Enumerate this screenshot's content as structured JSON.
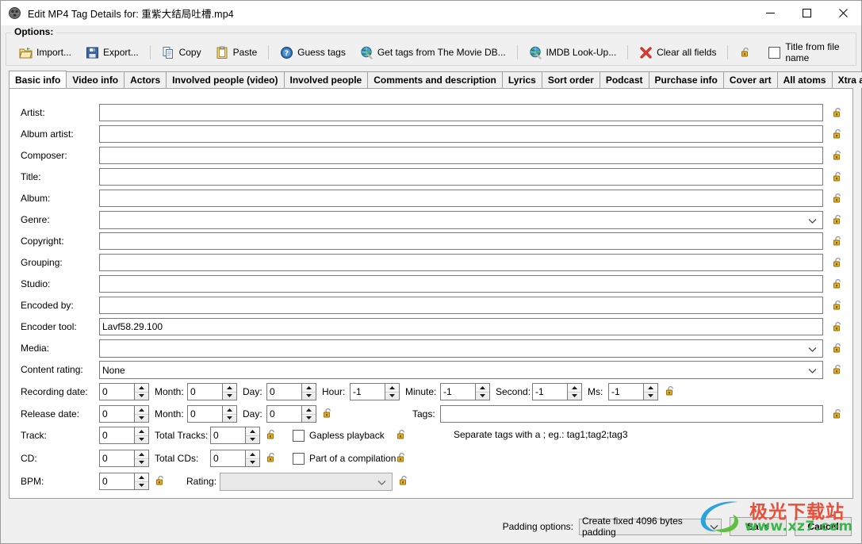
{
  "window": {
    "title": "Edit MP4 Tag Details for: 重紫大结局吐槽.mp4",
    "icon": "app-icon",
    "minimize": "–",
    "maximize": "□",
    "close": "✕"
  },
  "options": {
    "group_label": "Options:",
    "items": [
      {
        "label": "Import...",
        "icon": "open-folder-icon"
      },
      {
        "label": "Export...",
        "icon": "floppy-disk-icon"
      },
      {
        "label": "Copy",
        "icon": "copy-icon"
      },
      {
        "label": "Paste",
        "icon": "paste-icon"
      },
      {
        "label": "Guess tags",
        "icon": "question-circle-icon"
      },
      {
        "label": "Get tags from The Movie DB...",
        "icon": "globe-icon"
      },
      {
        "label": "IMDB Look-Up...",
        "icon": "globe-icon"
      },
      {
        "label": "Clear all fields",
        "icon": "red-x-icon"
      }
    ],
    "lock_icon": "unlocked-padlock-icon",
    "title_from_file": "Title from file name",
    "title_from_file_checked": false
  },
  "tabs": [
    {
      "label": "Basic info",
      "active": true
    },
    {
      "label": "Video info",
      "active": false
    },
    {
      "label": "Actors",
      "active": false
    },
    {
      "label": "Involved people (video)",
      "active": false
    },
    {
      "label": "Involved people",
      "active": false
    },
    {
      "label": "Comments and description",
      "active": false
    },
    {
      "label": "Lyrics",
      "active": false
    },
    {
      "label": "Sort order",
      "active": false
    },
    {
      "label": "Podcast",
      "active": false
    },
    {
      "label": "Purchase info",
      "active": false
    },
    {
      "label": "Cover art",
      "active": false
    },
    {
      "label": "All atoms",
      "active": false
    },
    {
      "label": "Xtra atom",
      "active": false
    }
  ],
  "basic_info": {
    "text_fields": [
      {
        "label": "Artist:",
        "value": ""
      },
      {
        "label": "Album artist:",
        "value": ""
      },
      {
        "label": "Composer:",
        "value": ""
      },
      {
        "label": "Title:",
        "value": ""
      },
      {
        "label": "Album:",
        "value": ""
      }
    ],
    "genre": {
      "label": "Genre:",
      "value": ""
    },
    "text_fields2": [
      {
        "label": "Copyright:",
        "value": ""
      },
      {
        "label": "Grouping:",
        "value": ""
      },
      {
        "label": "Studio:",
        "value": ""
      },
      {
        "label": "Encoded by:",
        "value": ""
      },
      {
        "label": "Encoder tool:",
        "value": "Lavf58.29.100"
      }
    ],
    "media": {
      "label": "Media:",
      "value": ""
    },
    "content_rating": {
      "label": "Content rating:",
      "value": "None"
    },
    "recording_date": {
      "label": "Recording date:",
      "year": "0",
      "month_label": "Month:",
      "month": "0",
      "day_label": "Day:",
      "day": "0",
      "hour_label": "Hour:",
      "hour": "-1",
      "minute_label": "Minute:",
      "minute": "-1",
      "second_label": "Second:",
      "second": "-1",
      "ms_label": "Ms:",
      "ms": "-1"
    },
    "release_date": {
      "label": "Release date:",
      "year": "0",
      "month_label": "Month:",
      "month": "0",
      "day_label": "Day:",
      "day": "0"
    },
    "tags": {
      "label": "Tags:",
      "value": "",
      "hint": "Separate tags with a ; eg.: tag1;tag2;tag3"
    },
    "track": {
      "label": "Track:",
      "value": "0",
      "total_label": "Total Tracks:",
      "total": "0",
      "checkbox_label": "Gapless playback",
      "checked": false
    },
    "cd": {
      "label": "CD:",
      "value": "0",
      "total_label": "Total CDs:",
      "total": "0",
      "checkbox_label": "Part of a compilation",
      "checked": false
    },
    "bpm": {
      "label": "BPM:",
      "value": "0",
      "rating_label": "Rating:",
      "rating_value": ""
    }
  },
  "footer": {
    "padding_label": "Padding options:",
    "padding_value": "Create fixed 4096 bytes padding",
    "save": "Save",
    "cancel": "Cancel"
  },
  "watermark": {
    "cn_text": "极光下载站",
    "url_text": "www.xz7.com",
    "cn_color": "#e8503a",
    "url_color": "#3cb54a"
  }
}
